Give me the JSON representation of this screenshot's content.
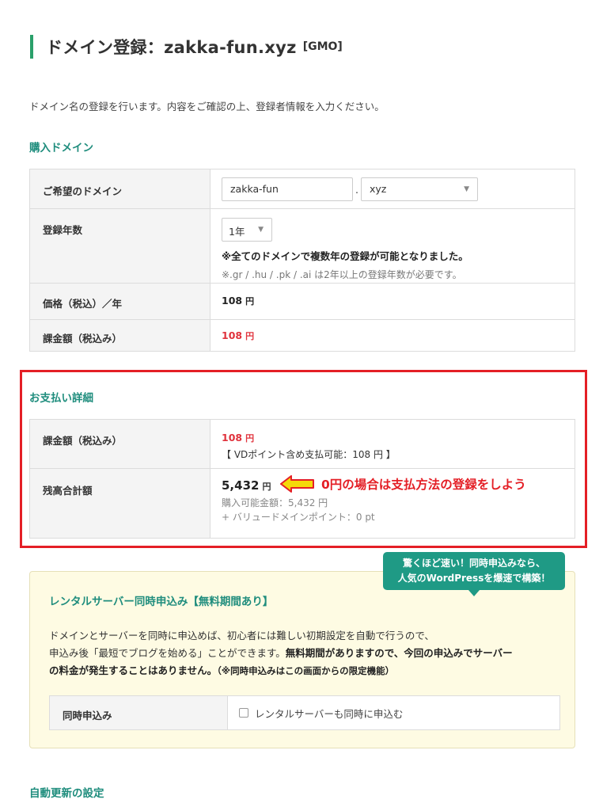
{
  "header": {
    "title": "ドメイン登録：zakka-fun.xyz",
    "tag": "[GMO]"
  },
  "intro": "ドメイン名の登録を行います。内容をご確認の上、登録者情報を入力ください。",
  "purchase": {
    "heading": "購入ドメイン",
    "rows": {
      "domain_label": "ご希望のドメイン",
      "domain_value": "zakka-fun",
      "dot": ".",
      "tld_value": "xyz",
      "years_label": "登録年数",
      "years_value": "1年",
      "years_note": "※全てのドメインで複数年の登録が可能となりました。",
      "years_subnote": "※.gr / .hu / .pk / .ai は2年以上の登録年数が必要です。",
      "price_label": "価格（税込）／年",
      "price_value": "108",
      "price_unit": "円",
      "charge_label": "課金額（税込み）",
      "charge_value": "108",
      "charge_unit": "円"
    }
  },
  "payment": {
    "heading": "お支払い詳細",
    "charge_label": "課金額（税込み）",
    "charge_value": "108",
    "charge_unit": "円",
    "charge_note": "【 VDポイント含め支払可能：108 円 】",
    "balance_label": "残高合計額",
    "balance_value": "5,432",
    "balance_unit": "円",
    "available": "購入可能金額：5,432 円",
    "points": "+ バリュードメインポイント：0 pt"
  },
  "annotation": "0円の場合は支払方法の登録をしよう",
  "bubble": {
    "line1": "驚くほど速い！同時申込みなら、",
    "line2": "人気のWordPressを爆速で構築！"
  },
  "server": {
    "title": "レンタルサーバー同時申込み【無料期間あり】",
    "text1": "ドメインとサーバーを同時に申込めば、初心者には難しい初期設定を自動で行うので、",
    "text2a": "申込み後「最短でブログを始める」ことができます。",
    "text2b": "無料期間がありますので、今回の申込みでサーバー",
    "text3a": "の料金が発生することはありません。",
    "text3b": "（※同時申込みはこの画面からの限定機能）",
    "row_label": "同時申込み",
    "checkbox_label": "レンタルサーバーも同時に申込む"
  },
  "auto_renew": {
    "heading": "自動更新の設定"
  },
  "colors": {
    "accent_green": "#1f8d7d",
    "title_bar": "#2aa06a",
    "alert_red": "#e41f26",
    "arrow_yellow": "#f5d90a"
  }
}
